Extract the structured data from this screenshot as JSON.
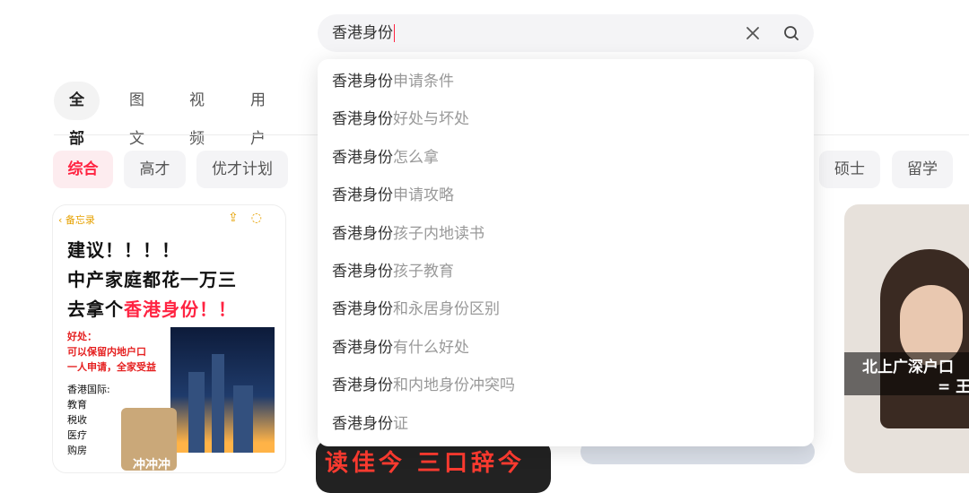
{
  "search": {
    "value": "香港身份",
    "clear_icon": "close-icon",
    "search_icon": "search-icon"
  },
  "tabs": [
    {
      "label": "全部",
      "active": true
    },
    {
      "label": "图文",
      "active": false
    },
    {
      "label": "视频",
      "active": false
    },
    {
      "label": "用户",
      "active": false
    }
  ],
  "filter_chips": [
    {
      "label": "综合",
      "active": true
    },
    {
      "label": "高才",
      "active": false
    },
    {
      "label": "优才计划",
      "active": false
    },
    {
      "label": "硕士",
      "active": false
    },
    {
      "label": "留学",
      "active": false
    }
  ],
  "suggestions": [
    {
      "keyword": "香港身份",
      "suffix": "申请条件"
    },
    {
      "keyword": "香港身份",
      "suffix": "好处与坏处"
    },
    {
      "keyword": "香港身份",
      "suffix": "怎么拿"
    },
    {
      "keyword": "香港身份",
      "suffix": "申请攻略"
    },
    {
      "keyword": "香港身份",
      "suffix": "孩子内地读书"
    },
    {
      "keyword": "香港身份",
      "suffix": "孩子教育"
    },
    {
      "keyword": "香港身份",
      "suffix": "和永居身份区别"
    },
    {
      "keyword": "香港身份",
      "suffix": "有什么好处"
    },
    {
      "keyword": "香港身份",
      "suffix": "和内地身份冲突吗"
    },
    {
      "keyword": "香港身份",
      "suffix": "证"
    }
  ],
  "cards": {
    "note": {
      "app_back": "备忘录",
      "line1": "建议！！！！",
      "line2": "中产家庭都花一万三",
      "line3_prefix": "去拿个",
      "line3_highlight": "香港身份",
      "line3_suffix": "！！",
      "benefit_title": "好处：",
      "benefit_1": "可以保留内地户口",
      "benefit_2": "一人申请，全家受益",
      "intl_title": "香港国际:",
      "items": [
        "教育",
        "税收",
        "医疗",
        "购房"
      ],
      "sticker_text": "冲冲冲"
    },
    "video": {
      "text": "读佳今 三口辞今"
    },
    "right": {
      "caption_1": "北上广深户口",
      "caption_2": "= 王"
    }
  },
  "colors": {
    "accent": "#ff2442",
    "chip_bg": "#f4f4f6"
  }
}
